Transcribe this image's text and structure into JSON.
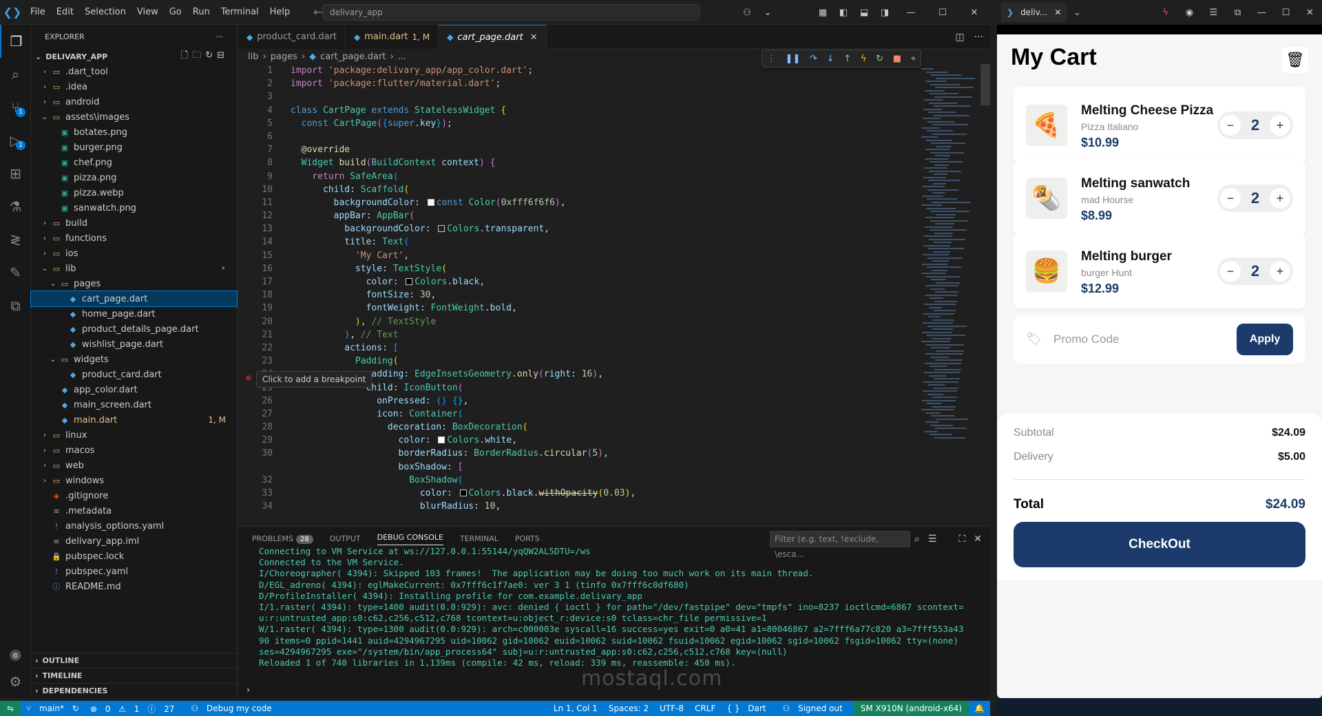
{
  "vscode": {
    "menu": [
      "File",
      "Edit",
      "Selection",
      "View",
      "Go",
      "Run",
      "Terminal",
      "Help"
    ],
    "command_center": "delivary_app",
    "explorer_title": "EXPLORER",
    "root_folder": "DELIVARY_APP",
    "tree": [
      {
        "label": ".dart_tool",
        "depth": 1,
        "kind": "folder",
        "open": false
      },
      {
        "label": ".idea",
        "depth": 1,
        "kind": "folder",
        "open": false
      },
      {
        "label": "android",
        "depth": 1,
        "kind": "folder",
        "open": false
      },
      {
        "label": "assets\\images",
        "depth": 1,
        "kind": "folder",
        "open": true
      },
      {
        "label": "botates.png",
        "depth": 2,
        "kind": "image"
      },
      {
        "label": "burger.png",
        "depth": 2,
        "kind": "image"
      },
      {
        "label": "chef.png",
        "depth": 2,
        "kind": "image"
      },
      {
        "label": "pizza.png",
        "depth": 2,
        "kind": "image"
      },
      {
        "label": "pizza.webp",
        "depth": 2,
        "kind": "image"
      },
      {
        "label": "sanwatch.png",
        "depth": 2,
        "kind": "image"
      },
      {
        "label": "build",
        "depth": 1,
        "kind": "folder",
        "open": false
      },
      {
        "label": "functions",
        "depth": 1,
        "kind": "folder",
        "open": false
      },
      {
        "label": "ios",
        "depth": 1,
        "kind": "folder",
        "open": false
      },
      {
        "label": "lib",
        "depth": 1,
        "kind": "folder",
        "open": true,
        "deco": "•"
      },
      {
        "label": "pages",
        "depth": 2,
        "kind": "folder",
        "open": true
      },
      {
        "label": "cart_page.dart",
        "depth": 3,
        "kind": "dart",
        "selected": true
      },
      {
        "label": "home_page.dart",
        "depth": 3,
        "kind": "dart"
      },
      {
        "label": "product_details_page.dart",
        "depth": 3,
        "kind": "dart"
      },
      {
        "label": "wishlist_page.dart",
        "depth": 3,
        "kind": "dart"
      },
      {
        "label": "widgets",
        "depth": 2,
        "kind": "folder",
        "open": true
      },
      {
        "label": "product_card.dart",
        "depth": 3,
        "kind": "dart"
      },
      {
        "label": "app_color.dart",
        "depth": 2,
        "kind": "dart"
      },
      {
        "label": "main_screen.dart",
        "depth": 2,
        "kind": "dart"
      },
      {
        "label": "main.dart",
        "depth": 2,
        "kind": "dart",
        "modified": true,
        "deco": "1, M"
      },
      {
        "label": "linux",
        "depth": 1,
        "kind": "folder",
        "open": false
      },
      {
        "label": "macos",
        "depth": 1,
        "kind": "folder",
        "open": false
      },
      {
        "label": "web",
        "depth": 1,
        "kind": "folder",
        "open": false
      },
      {
        "label": "windows",
        "depth": 1,
        "kind": "folder",
        "open": false
      },
      {
        "label": ".gitignore",
        "depth": 1,
        "kind": "git"
      },
      {
        "label": ".metadata",
        "depth": 1,
        "kind": "file"
      },
      {
        "label": "analysis_options.yaml",
        "depth": 1,
        "kind": "yaml"
      },
      {
        "label": "delivary_app.iml",
        "depth": 1,
        "kind": "file"
      },
      {
        "label": "pubspec.lock",
        "depth": 1,
        "kind": "lock"
      },
      {
        "label": "pubspec.yaml",
        "depth": 1,
        "kind": "yaml"
      },
      {
        "label": "README.md",
        "depth": 1,
        "kind": "info"
      }
    ],
    "side_sections": [
      "OUTLINE",
      "TIMELINE",
      "DEPENDENCIES"
    ],
    "tabs": [
      {
        "label": "product_card.dart",
        "active": false
      },
      {
        "label": "main.dart",
        "active": false,
        "mod": "1, M"
      },
      {
        "label": "cart_page.dart",
        "active": true
      }
    ],
    "breadcrumbs": [
      "lib",
      "pages",
      "cart_page.dart",
      "..."
    ],
    "tooltip": "Click to add a breakpoint",
    "panel_tabs": [
      "PROBLEMS",
      "OUTPUT",
      "DEBUG CONSOLE",
      "TERMINAL",
      "PORTS"
    ],
    "problems_count": "28",
    "filter_placeholder": "Filter (e.g. text, !exclude, \\esca...",
    "console_lines": [
      "Connecting to VM Service at ws://127.0.0.1:55144/yqQW2AL5DTU=/ws",
      "Connected to the VM Service.",
      "I/Choreographer( 4394): Skipped 103 frames!  The application may be doing too much work on its main thread.",
      "D/EGL_adreno( 4394): eglMakeCurrent: 0x7fff6c1f7ae0: ver 3 1 (tinfo 0x7fff6c0df680)",
      "D/ProfileInstaller( 4394): Installing profile for com.example.delivary_app",
      "I/1.raster( 4394): type=1400 audit(0.0:929): avc: denied { ioctl } for path=\"/dev/fastpipe\" dev=\"tmpfs\" ino=8237 ioctlcmd=6867 scontext=",
      "u:r:untrusted_app:s0:c62,c256,c512,c768 tcontext=u:object_r:device:s0 tclass=chr_file permissive=1",
      "W/1.raster( 4394): type=1300 audit(0.0:929): arch=c000003e syscall=16 success=yes exit=0 a0=41 a1=80046867 a2=7fff6a77c820 a3=7fff553a43",
      "90 items=0 ppid=1441 auid=4294967295 uid=10062 gid=10062 euid=10062 suid=10062 fsuid=10062 egid=10062 sgid=10062 fsgid=10062 tty=(none)",
      "ses=4294967295 exe=\"/system/bin/app_process64\" subj=u:r:untrusted_app:s0:c62,c256,c512,c768 key=(null)",
      "Reloaded 1 of 740 libraries in 1,139ms (compile: 42 ms, reload: 339 ms, reassemble: 450 ms)."
    ],
    "status": {
      "branch": "main*",
      "errors": "0",
      "warnings": "1",
      "infos": "27",
      "debug": "Debug my code",
      "position": "Ln 1, Col 1",
      "spaces": "Spaces: 2",
      "encoding": "UTF-8",
      "eol": "CRLF",
      "language": "Dart",
      "signed": "Signed out",
      "device": "SM X910N (android-x64)"
    },
    "watermark": "mostaql.com"
  },
  "emulator": {
    "tab_label": "deliv...",
    "app": {
      "title": "My Cart",
      "items": [
        {
          "name": "Melting Cheese Pizza",
          "shop": "Pizza Italiano",
          "price": "$10.99",
          "qty": "2",
          "emoji": "🍕"
        },
        {
          "name": "Melting sanwatch",
          "shop": "mad Hourse",
          "price": "$8.99",
          "qty": "2",
          "emoji": "🌯"
        },
        {
          "name": "Melting  burger",
          "shop": "burger Hunt",
          "price": "$12.99",
          "qty": "2",
          "emoji": "🍔"
        }
      ],
      "promo_placeholder": "Promo Code",
      "apply_label": "Apply",
      "subtotal_label": "Subtotal",
      "subtotal_value": "$24.09",
      "delivery_label": "Delivery",
      "delivery_value": "$5.00",
      "total_label": "Total",
      "total_value": "$24.09",
      "checkout_label": "CheckOut"
    }
  }
}
